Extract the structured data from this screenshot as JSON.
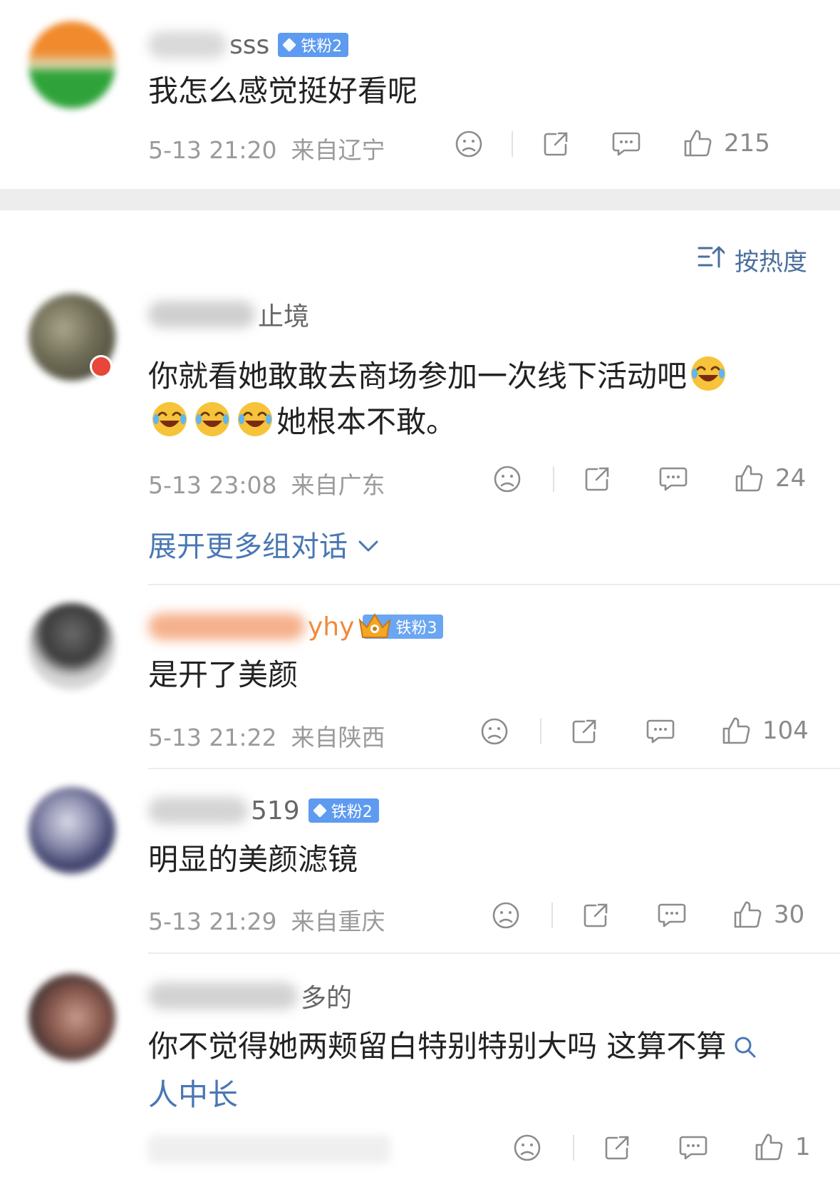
{
  "colors": {
    "link": "#4a77b3",
    "meta_text": "#9a9a9a",
    "badge_blue": "#5e9bf0",
    "emoji_yellow": "#f6c33a"
  },
  "sort": {
    "label": "按热度",
    "icon": "sort-icon"
  },
  "expand": {
    "label": "展开更多组对话",
    "icon": "chevron-down-icon"
  },
  "comments": [
    {
      "username_visible": "sss",
      "badge": "铁粉2",
      "text": "我怎么感觉挺好看呢",
      "time": "5-13 21:20",
      "location": "来自辽宁",
      "likes": "215"
    },
    {
      "username_visible": "止境",
      "badge": "",
      "text_line1": "你就看她敢敢去商场参加一次线下活动吧",
      "text_line2": "她根本不敢。",
      "time": "5-13 23:08",
      "location": "来自广东",
      "likes": "24"
    },
    {
      "username_visible": "yhy",
      "badge": "铁粉3",
      "text": "是开了美颜",
      "time": "5-13 21:22",
      "location": "来自陕西",
      "likes": "104"
    },
    {
      "username_visible": "519",
      "badge": "铁粉2",
      "text": "明显的美颜滤镜",
      "time": "5-13 21:29",
      "location": "来自重庆",
      "likes": "30"
    },
    {
      "username_visible": "多的",
      "badge": "",
      "text_line1": "你不觉得她两颊留白特别特别大吗 这算不算",
      "text_line2_link": "人中长",
      "likes": "1"
    }
  ]
}
